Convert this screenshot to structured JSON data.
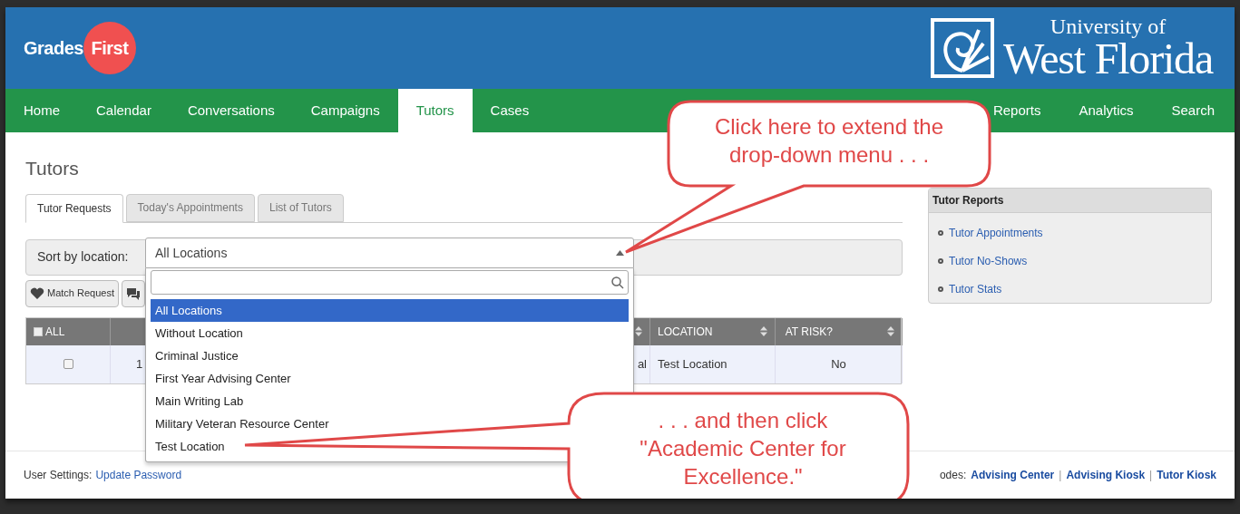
{
  "logo": {
    "left": "Grades",
    "right": "First"
  },
  "university": {
    "line1": "University of",
    "line2": "West Florida"
  },
  "nav": [
    {
      "label": "Home",
      "selected": false
    },
    {
      "label": "Calendar",
      "selected": false
    },
    {
      "label": "Conversations",
      "selected": false
    },
    {
      "label": "Campaigns",
      "selected": false
    },
    {
      "label": "Tutors",
      "selected": true
    },
    {
      "label": "Cases",
      "selected": false
    }
  ],
  "nav_right": [
    {
      "label": "Reports",
      "selected": false
    },
    {
      "label": "Analytics",
      "selected": false
    },
    {
      "label": "Search",
      "selected": false
    }
  ],
  "page_title": "Tutors",
  "tabs": [
    {
      "label": "Tutor Requests",
      "selected": true
    },
    {
      "label": "Today's Appointments",
      "selected": false
    },
    {
      "label": "List of Tutors",
      "selected": false
    }
  ],
  "filter": {
    "label": "Sort by location:",
    "value": "All Locations",
    "expanded": true,
    "options": [
      {
        "label": "All Locations",
        "selected": true
      },
      {
        "label": "Without Location",
        "selected": false
      },
      {
        "label": "Criminal Justice",
        "selected": false
      },
      {
        "label": "First Year Advising Center",
        "selected": false
      },
      {
        "label": "Main Writing Lab",
        "selected": false
      },
      {
        "label": "Military Veteran Resource Center",
        "selected": false
      },
      {
        "label": "Test Location",
        "selected": false
      }
    ]
  },
  "actions": [
    {
      "kind": "heart",
      "label": "Match Request"
    },
    {
      "kind": "chat"
    }
  ],
  "table": {
    "select_all": {
      "label": "ALL",
      "checked": false
    },
    "columns": [
      {
        "kind": "plain"
      },
      {
        "kind": "sortable"
      },
      {
        "kind": "sortable",
        "label": "LOCATION"
      },
      {
        "kind": "sortable",
        "label": "AT RISK?"
      }
    ],
    "rows": [
      {
        "checked": false,
        "cells": [
          "1",
          "al",
          "Test Location",
          "No"
        ]
      }
    ]
  },
  "sidebar": {
    "title": "Tutor Reports",
    "links": [
      "Tutor Appointments",
      "Tutor No-Shows",
      "Tutor Stats"
    ]
  },
  "footer": {
    "settings_label": "User Settings:",
    "settings_link": "Update Password",
    "modes_label": "odes:",
    "separator": "|",
    "modes": [
      "Advising Center",
      "Advising Kiosk",
      "Tutor Kiosk"
    ]
  },
  "callouts": [
    {
      "text": "Click here to extend the drop-down menu . . ."
    },
    {
      "text": ". . . and then click \"Academic Center for Excellence.\""
    }
  ]
}
